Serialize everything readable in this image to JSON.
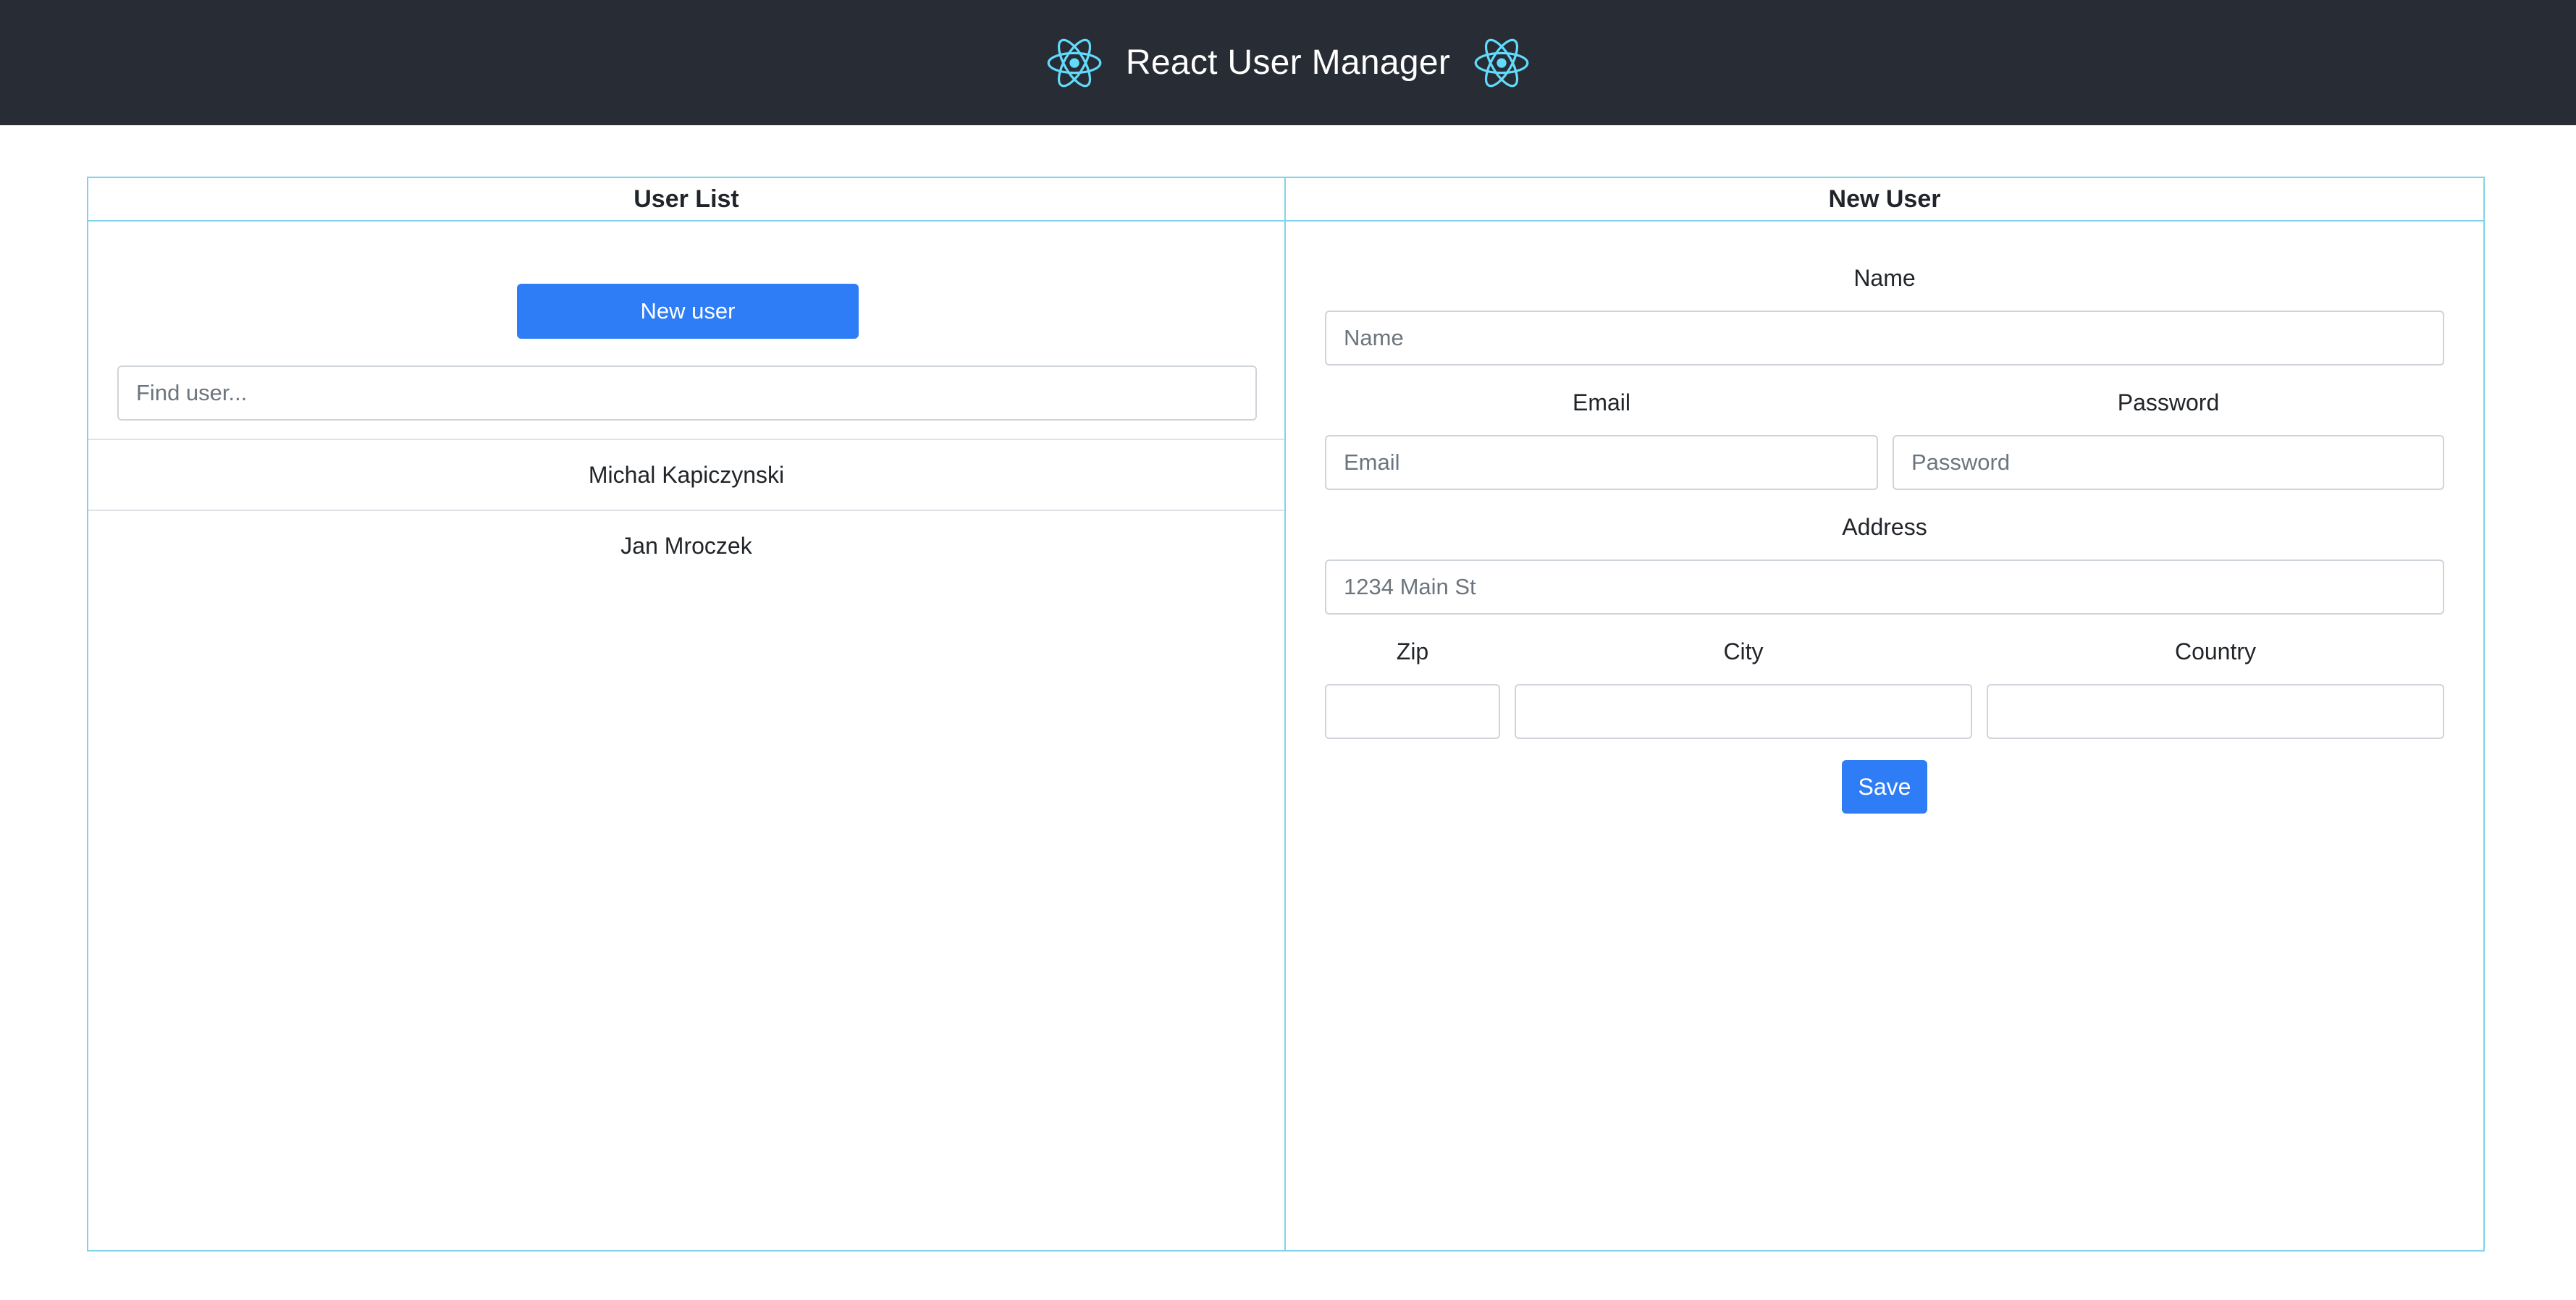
{
  "header": {
    "title": "React User Manager",
    "logo_icon": "react-atom-icon",
    "background_color": "#282c34",
    "logo_color": "#61dafb"
  },
  "user_list": {
    "title": "User List",
    "new_user_button": "New user",
    "search_placeholder": "Find user...",
    "users": [
      {
        "name": "Michal Kapiczynski"
      },
      {
        "name": "Jan Mroczek"
      }
    ]
  },
  "new_user_form": {
    "title": "New User",
    "name_label": "Name",
    "name_placeholder": "Name",
    "email_label": "Email",
    "email_placeholder": "Email",
    "password_label": "Password",
    "password_placeholder": "Password",
    "address_label": "Address",
    "address_placeholder": "1234 Main St",
    "zip_label": "Zip",
    "city_label": "City",
    "country_label": "Country",
    "save_button": "Save"
  },
  "colors": {
    "accent": "#2f7df6",
    "panel_border": "#7fd3ec"
  }
}
